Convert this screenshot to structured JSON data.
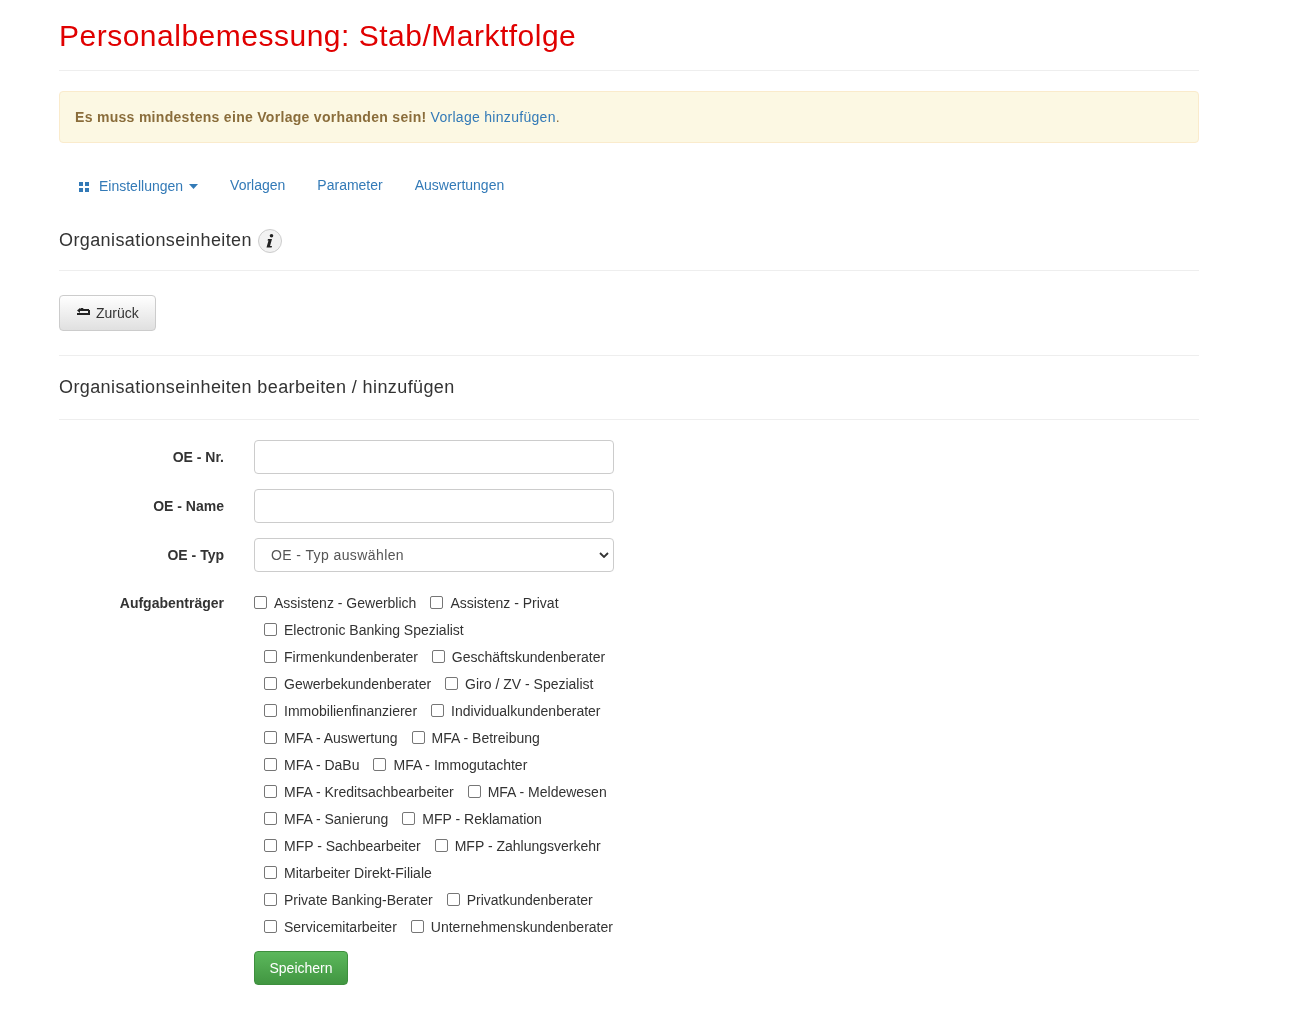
{
  "title": "Personalbemessung: Stab/Marktfolge",
  "alert": {
    "message": "Es muss mindestens eine Vorlage vorhanden sein!",
    "link": "Vorlage hinzufügen",
    "suffix": "."
  },
  "nav": [
    {
      "label": "Einstellungen",
      "kind": "dropdown"
    },
    {
      "label": "Vorlagen",
      "kind": "link"
    },
    {
      "label": "Parameter",
      "kind": "link"
    },
    {
      "label": "Auswertungen",
      "kind": "link"
    }
  ],
  "section_title": "Organisationseinheiten",
  "back_button": "Zurück",
  "form_title": "Organisationseinheiten bearbeiten / hinzufügen",
  "fields": [
    {
      "label": "OE - Nr.",
      "kind": "text"
    },
    {
      "label": "OE - Name",
      "kind": "text"
    },
    {
      "label": "OE - Typ",
      "kind": "select",
      "value": "OE - Typ auswählen"
    }
  ],
  "aufgabentraeger": {
    "label": "Aufgabenträger",
    "rows": [
      [
        {
          "label": "Assistenz - Gewerblich",
          "checked": false
        },
        {
          "label": "Assistenz - Privat",
          "checked": false
        }
      ],
      [
        {
          "label": "Electronic Banking Spezialist",
          "checked": false
        }
      ],
      [
        {
          "label": "Firmenkundenberater",
          "checked": false
        },
        {
          "label": "Geschäftskundenberater",
          "checked": false
        }
      ],
      [
        {
          "label": "Gewerbekundenberater",
          "checked": false
        },
        {
          "label": "Giro / ZV - Spezialist",
          "checked": false
        }
      ],
      [
        {
          "label": "Immobilienfinanzierer",
          "checked": false
        },
        {
          "label": "Individualkundenberater",
          "checked": false
        }
      ],
      [
        {
          "label": "MFA - Auswertung",
          "checked": false
        },
        {
          "label": "MFA - Betreibung",
          "checked": false
        }
      ],
      [
        {
          "label": "MFA - DaBu",
          "checked": false
        },
        {
          "label": "MFA - Immogutachter",
          "checked": false
        }
      ],
      [
        {
          "label": "MFA - Kreditsachbearbeiter",
          "checked": false
        },
        {
          "label": "MFA - Meldewesen",
          "checked": false
        }
      ],
      [
        {
          "label": "MFA - Sanierung",
          "checked": false
        },
        {
          "label": "MFP - Reklamation",
          "checked": false
        }
      ],
      [
        {
          "label": "MFP - Sachbearbeiter",
          "checked": false
        },
        {
          "label": "MFP - Zahlungsverkehr",
          "checked": false
        }
      ],
      [
        {
          "label": "Mitarbeiter Direkt-Filiale",
          "checked": false
        }
      ],
      [
        {
          "label": "Private Banking-Berater",
          "checked": false
        },
        {
          "label": "Privatkundenberater",
          "checked": false
        }
      ],
      [
        {
          "label": "Servicemitarbeiter",
          "checked": false
        },
        {
          "label": "Unternehmenskundenberater",
          "checked": false
        }
      ]
    ]
  },
  "save_button": "Speichern"
}
